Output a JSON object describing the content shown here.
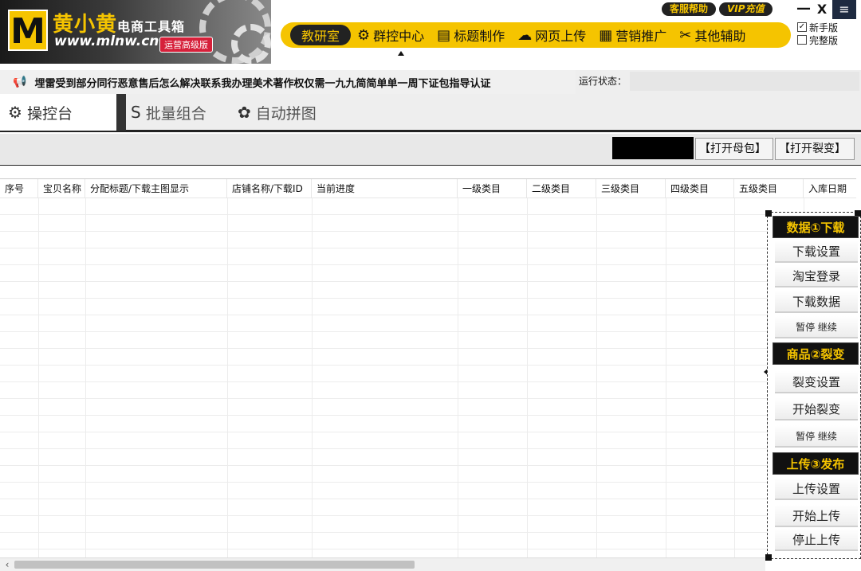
{
  "app": {
    "logo_letter": "M",
    "logo_name": "黄小黄",
    "logo_subname": "电商工具箱",
    "logo_url": "www.mlnw.cn",
    "logo_badge": "运营高级版"
  },
  "top_buttons": {
    "service": "客服帮助",
    "vip": "VIP充值"
  },
  "window": {
    "minimize": "—",
    "close": "X",
    "menu": "≡"
  },
  "nav": {
    "items": [
      {
        "label": "教研室",
        "icon": ""
      },
      {
        "label": "群控中心",
        "icon": "⚙"
      },
      {
        "label": "标题制作",
        "icon": "▤"
      },
      {
        "label": "网页上传",
        "icon": "☁"
      },
      {
        "label": "营销推广",
        "icon": "▦"
      },
      {
        "label": "其他辅助",
        "icon": "✂"
      }
    ]
  },
  "modes": {
    "novice": {
      "label": "新手版",
      "checked": "✓"
    },
    "full": {
      "label": "完整版",
      "checked": ""
    }
  },
  "notice": {
    "icon": "📢",
    "text": "埋雷受到部分同行恶意售后怎么解决联系我办理美术著作权仅需一九九简简单单一周下证包指导认证",
    "status_label": "运行状态："
  },
  "tabs": [
    {
      "label": "操控台",
      "icon": "⚙"
    },
    {
      "label": "批量组合",
      "icon": "S"
    },
    {
      "label": "自动拼图",
      "icon": "✿"
    }
  ],
  "actions": {
    "open_mother": "【打开母包】",
    "open_split": "【打开裂变】"
  },
  "table": {
    "columns": [
      "序号",
      "宝贝名称",
      "分配标题/下载主图显示",
      "店铺名称/下载ID",
      "当前进度",
      "一级类目",
      "二级类目",
      "三级类目",
      "四级类目",
      "五级类目",
      "入库日期"
    ]
  },
  "side_panel": {
    "sections": [
      {
        "title": "数据①下载",
        "buttons": [
          "下载设置",
          "淘宝登录",
          "下载数据",
          "暂停  继续"
        ]
      },
      {
        "title": "商品②裂变",
        "buttons": [
          "裂变设置",
          "开始裂变",
          "暂停  继续"
        ]
      },
      {
        "title": "上传③发布",
        "buttons": [
          "上传设置",
          "开始上传",
          "停止上传"
        ]
      }
    ]
  },
  "scrollbar": {
    "left_arrow": "‹"
  },
  "colors": {
    "brand_yellow": "#f5c400",
    "dark": "#111111"
  }
}
